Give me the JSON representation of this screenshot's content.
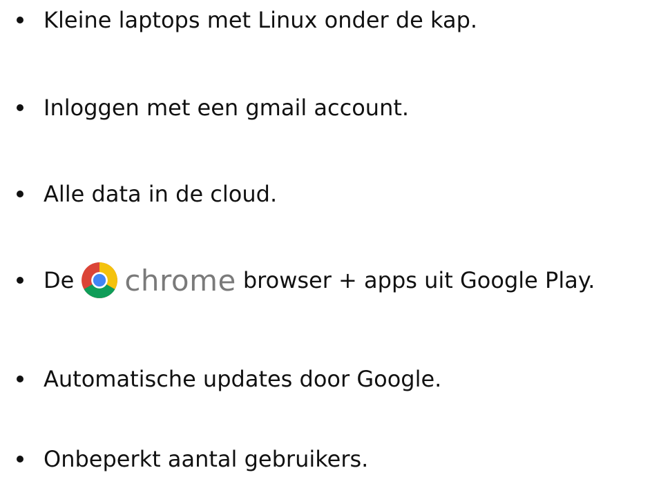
{
  "bullets": [
    {
      "text": "Kleine laptops met Linux onder de kap."
    },
    {
      "text": "Inloggen met een gmail account."
    },
    {
      "text": "Alle data in de cloud."
    },
    {
      "prefix": "De",
      "logo_word": "chrome",
      "suffix": "browser + apps uit Google Play."
    },
    {
      "text": "Automatische updates door Google."
    },
    {
      "text": "Onbeperkt aantal gebruikers."
    }
  ],
  "logo": {
    "icon": "chrome-icon",
    "colors": {
      "red": "#db4437",
      "yellow": "#f4c20d",
      "green": "#0f9d58",
      "blue": "#4285f4"
    }
  }
}
